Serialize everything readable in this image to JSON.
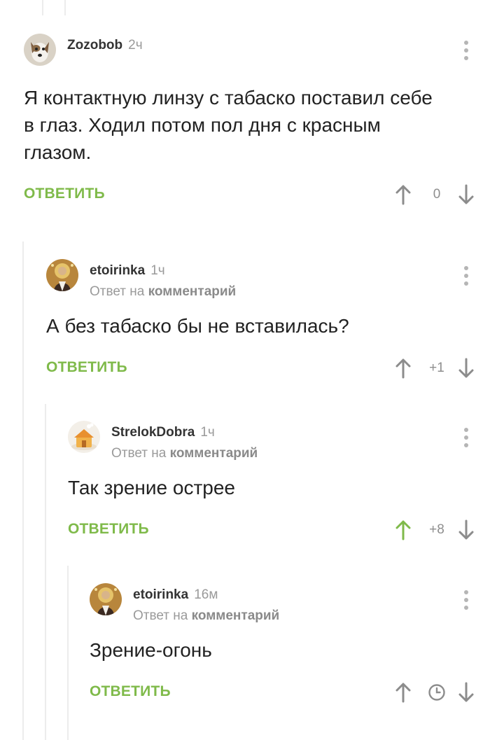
{
  "comments": [
    {
      "username": "Zozobob",
      "time": "2ч",
      "text": "Я контактную линзу с табаско поставил себе в глаз. Ходил потом пол дня с красным глазом.",
      "reply_label": "ОТВЕТИТЬ",
      "score": "0",
      "upvoted": false,
      "avatar_icon": "dog-avatar"
    },
    {
      "username": "etoirinka",
      "time": "1ч",
      "reply_prefix": "Ответ на",
      "reply_target": "комментарий",
      "text": "А без табаско бы не вставилась?",
      "reply_label": "ОТВЕТИТЬ",
      "score": "+1",
      "upvoted": false,
      "avatar_icon": "icon-portrait-avatar"
    },
    {
      "username": "StrelokDobra",
      "time": "1ч",
      "reply_prefix": "Ответ на",
      "reply_target": "комментарий",
      "text": "Так зрение острее",
      "reply_label": "ОТВЕТИТЬ",
      "score": "+8",
      "upvoted": true,
      "avatar_icon": "house-avatar"
    },
    {
      "username": "etoirinka",
      "time": "16м",
      "reply_prefix": "Ответ на",
      "reply_target": "комментарий",
      "text": "Зрение-огонь",
      "reply_label": "ОТВЕТИТЬ",
      "score_icon": "clock-icon",
      "upvoted": false,
      "avatar_icon": "icon-portrait-avatar"
    }
  ],
  "colors": {
    "accent_green": "#7fba4a",
    "muted": "#9a9a9a",
    "thread_line": "#ececec"
  }
}
